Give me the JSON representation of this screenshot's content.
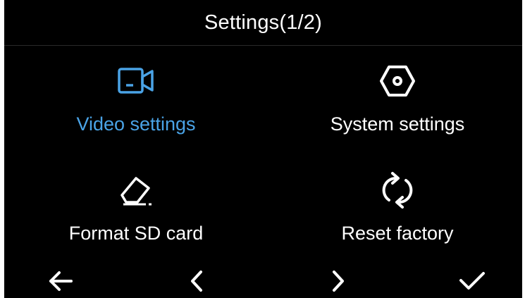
{
  "header": {
    "title": "Settings(1/2)"
  },
  "menu": {
    "items": [
      {
        "label": "Video settings",
        "icon": "video-camera-icon",
        "selected": true
      },
      {
        "label": "System settings",
        "icon": "hexagon-nut-icon",
        "selected": false
      },
      {
        "label": "Format SD card",
        "icon": "eraser-icon",
        "selected": false
      },
      {
        "label": "Reset factory",
        "icon": "refresh-icon",
        "selected": false
      }
    ]
  },
  "footer": {
    "buttons": [
      {
        "icon": "arrow-left-icon"
      },
      {
        "icon": "chevron-left-icon"
      },
      {
        "icon": "chevron-right-icon"
      },
      {
        "icon": "checkmark-icon"
      }
    ]
  },
  "colors": {
    "background": "#000000",
    "text": "#ffffff",
    "accent": "#4aa3e6"
  }
}
